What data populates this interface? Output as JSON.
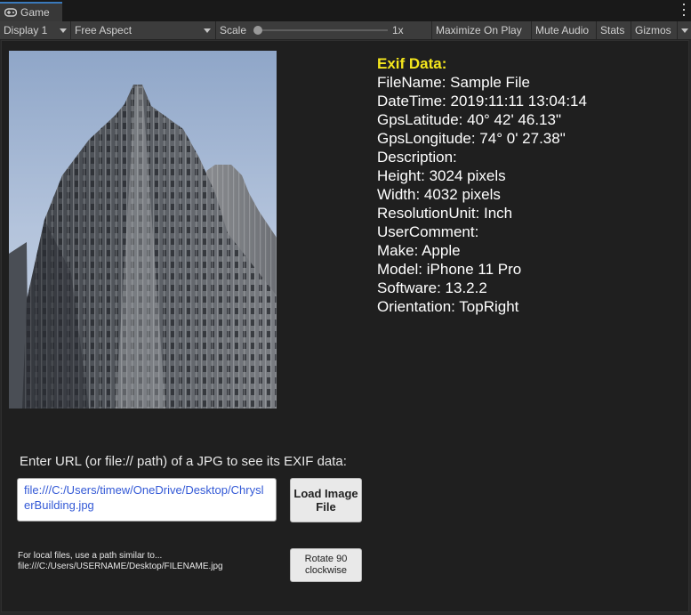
{
  "tab": {
    "label": "Game",
    "icon": "gamepad-icon"
  },
  "toolbar": {
    "display": "Display 1",
    "aspect": "Free Aspect",
    "scale_label": "Scale",
    "scale_value": "1x",
    "scale_level": 0.0,
    "maximize": "Maximize On Play",
    "mute": "Mute Audio",
    "stats": "Stats",
    "gizmos": "Gizmos"
  },
  "exif": {
    "title": "Exif Data:",
    "lines": [
      "FileName: Sample File",
      "DateTime: 2019:11:11 13:04:14",
      "GpsLatitude: 40° 42' 46.13\"",
      "GpsLongitude: 74° 0' 27.38\"",
      "Description:",
      "Height: 3024 pixels",
      "Width: 4032 pixels",
      "ResolutionUnit: Inch",
      "UserComment:",
      "Make: Apple",
      "Model: iPhone 11 Pro",
      "Software: 13.2.2",
      "Orientation: TopRight"
    ]
  },
  "input": {
    "prompt": "Enter URL (or file:// path) of a JPG to see its EXIF data:",
    "value": "file:///C:/Users/timew/OneDrive/Desktop/ChryslerBuilding.jpg"
  },
  "buttons": {
    "load": "Load Image File",
    "rotate": "Rotate 90 clockwise"
  },
  "hint": {
    "line1": "For local files, use a path similar to...",
    "line2": "file:///C:/Users/USERNAME/Desktop/FILENAME.jpg"
  },
  "colors": {
    "exif_title": "#f4e61c",
    "url_text": "#3359d6",
    "tab_accent": "#3a79bb"
  }
}
